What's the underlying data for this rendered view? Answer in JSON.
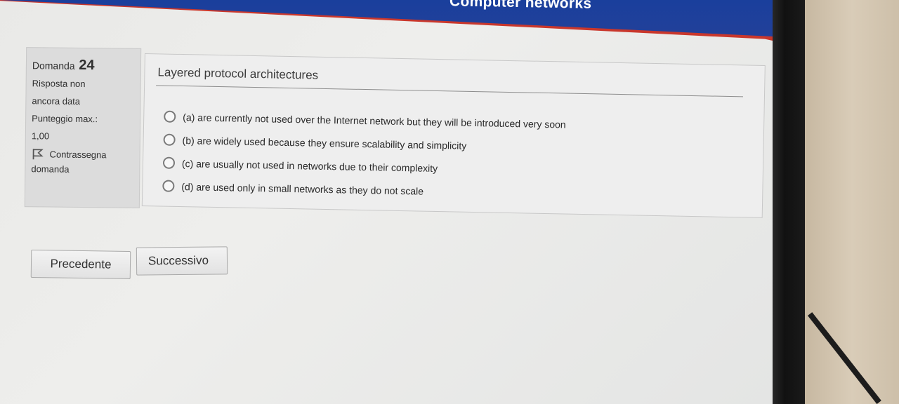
{
  "header": {
    "course_title": "Computer networks"
  },
  "info": {
    "question_label": "Domanda",
    "question_number": "24",
    "status_line1": "Risposta non",
    "status_line2": "ancora data",
    "score_line1": "Punteggio max.:",
    "score_line2": "1,00",
    "flag_line1": "Contrassegna",
    "flag_line2": "domanda"
  },
  "question": {
    "title": "Layered protocol architectures",
    "options": [
      {
        "label": "(a) are currently not used over the Internet network but they will be introduced very soon"
      },
      {
        "label": "(b) are widely used because they ensure scalability and simplicity"
      },
      {
        "label": "(c) are usually not used in networks due to their complexity"
      },
      {
        "label": "(d) are used only in small networks as they do not scale"
      }
    ]
  },
  "navigation": {
    "prev_label": "Precedente",
    "next_label": "Successivo"
  },
  "colors": {
    "header_blue": "#1a3f9c",
    "header_red": "#c9372c"
  }
}
